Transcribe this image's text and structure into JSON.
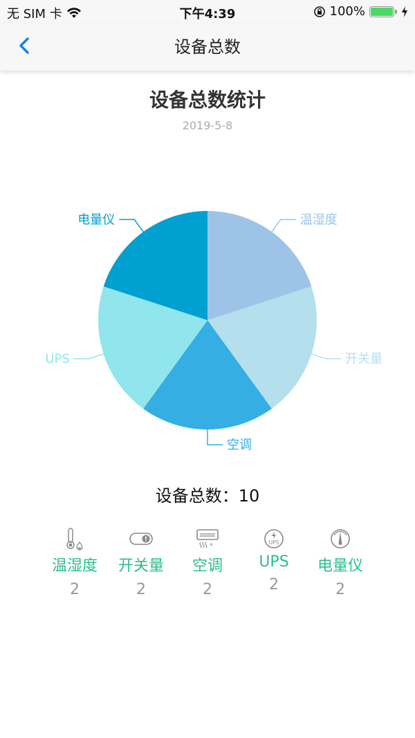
{
  "status_bar": {
    "carrier": "无 SIM 卡",
    "time": "下午4:39",
    "battery": "100%",
    "icons": [
      "wifi-icon",
      "rotation-lock-icon",
      "battery-icon",
      "charging-icon"
    ]
  },
  "navbar": {
    "title": "设备总数",
    "back_icon": "chevron-left-icon"
  },
  "chart_data": {
    "type": "pie",
    "title": "设备总数统计",
    "subtitle": "2019-5-8",
    "categories": [
      "温湿度",
      "开关量",
      "空调",
      "UPS",
      "电量仪"
    ],
    "values": [
      2,
      2,
      2,
      2,
      2
    ],
    "colors": [
      "#9dc3e6",
      "#b5dfed",
      "#35aee3",
      "#90e6ec",
      "#00a0d0"
    ],
    "legend": "none",
    "labels_outside": true
  },
  "summary": {
    "total_label": "设备总数：",
    "total_value": "10"
  },
  "devices": [
    {
      "icon": "thermometer-humidity-icon",
      "label": "温湿度",
      "count": "2"
    },
    {
      "icon": "switch-icon",
      "label": "开关量",
      "count": "2"
    },
    {
      "icon": "air-conditioner-icon",
      "label": "空调",
      "count": "2"
    },
    {
      "icon": "ups-icon",
      "label": "UPS",
      "count": "2"
    },
    {
      "icon": "power-meter-icon",
      "label": "电量仪",
      "count": "2"
    }
  ],
  "colors": {
    "accent": "#1a7fe8",
    "device_label": "#2bbf8a"
  }
}
